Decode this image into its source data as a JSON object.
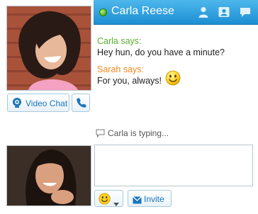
{
  "header": {
    "contact_name": "Carla Reese",
    "status_color": "#4caf1a",
    "icons": [
      "person-icon",
      "contact-card-icon",
      "chat-bubble-icon"
    ]
  },
  "left_panel": {
    "video_chat_label": "Video Chat",
    "call_icon": "phone-icon"
  },
  "conversation": {
    "messages": [
      {
        "sender": "Carla says:",
        "text": "Hey hun, do you have a minute?",
        "sender_color": "#5ab031"
      },
      {
        "sender": "Sarah says:",
        "text": "For you, always!",
        "sender_color": "#f0891c",
        "emoticon": "smile-emoticon"
      }
    ],
    "typing_status": "Carla is typing..."
  },
  "composer": {
    "value": "",
    "invite_label": "Invite"
  },
  "colors": {
    "header_top": "#4db7ec",
    "header_bottom": "#1c8fd2",
    "link_blue": "#1a75bb"
  }
}
